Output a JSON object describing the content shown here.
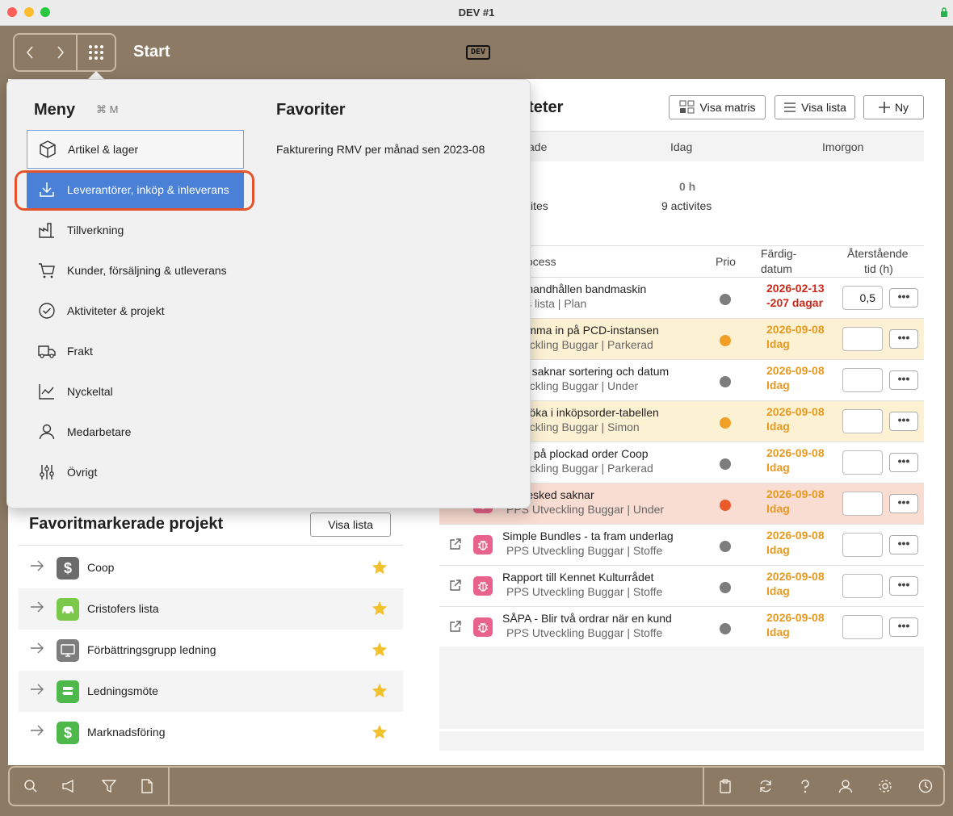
{
  "window": {
    "title": "DEV #1"
  },
  "header": {
    "page_title": "Start",
    "logo_text": "DEV"
  },
  "menu": {
    "title": "Meny",
    "shortcut": "⌘ M",
    "items": [
      {
        "label": "Artikel & lager",
        "icon": "box-icon"
      },
      {
        "label": "Leverantörer, inköp & inleverans",
        "icon": "download-icon"
      },
      {
        "label": "Tillverkning",
        "icon": "factory-icon"
      },
      {
        "label": "Kunder, försäljning & utleverans",
        "icon": "cart-icon"
      },
      {
        "label": "Aktiviteter & projekt",
        "icon": "check-circle-icon"
      },
      {
        "label": "Frakt",
        "icon": "truck-icon"
      },
      {
        "label": "Nyckeltal",
        "icon": "line-chart-icon"
      },
      {
        "label": "Medarbetare",
        "icon": "person-icon"
      },
      {
        "label": "Övrigt",
        "icon": "sliders-icon"
      }
    ]
  },
  "favorites": {
    "title": "Favoriter",
    "links": [
      "Fakturering RMV per månad sen 2023-08"
    ]
  },
  "activities": {
    "title": "erade aktiviteter",
    "buttons": {
      "matrix": "Visa matris",
      "list": "Visa lista",
      "new": "Ny"
    },
    "summary_headers": [
      "ade",
      "Idag",
      "Imorgon"
    ],
    "summary_values": {
      "col1_count": "ites",
      "today_hours": "0 h",
      "today_count": "9 activites"
    },
    "table_headers": {
      "process": "ocess",
      "prio": "Prio",
      "date_l1": "Färdig-",
      "date_l2": "datum",
      "rem_l1": "Återstående",
      "rem_l2": "tid (h)"
    },
    "more_label": "•••",
    "rows": [
      {
        "title": "rhåll handhållen bandmaskin",
        "sub": "ofers lista | Plan",
        "prio": "#7d7d7d",
        "date": "2026-02-13",
        "due": "-207 dagar",
        "date_color": "#c92a1b",
        "remaining": "0,5",
        "bg": "#ffffff"
      },
      {
        "title": "te komma in på PCD-instansen",
        "sub": "Utveckling Buggar | Parkerad",
        "prio": "#f0a027",
        "date": "2026-09-08",
        "due": "Idag",
        "date_color": "#e69a22",
        "remaining": "",
        "bg": "#fdf1d4"
      },
      {
        "title": "listan saknar sortering och datum",
        "sub": "Utveckling Buggar | Under",
        "prio": "#7d7d7d",
        "date": "2026-09-08",
        "due": "Idag",
        "date_color": "#e69a22",
        "remaining": "",
        "bg": "#ffffff"
      },
      {
        "title": "j att söka i inköpsorder-tabellen",
        "sub": "Utveckling Buggar | Simon",
        "prio": "#f0a027",
        "date": "2026-09-08",
        "due": "Idag",
        "date_color": "#e69a22",
        "remaining": "",
        "bg": "#fdf1d4"
      },
      {
        "title": "ner in på plockad order Coop",
        "sub": "Utveckling Buggar | Parkerad",
        "prio": "#7d7d7d",
        "date": "2026-09-08",
        "due": "Idag",
        "date_color": "#e69a22",
        "remaining": "",
        "bg": "#ffffff"
      },
      {
        "title": "ansbesked saknar",
        "sub": "PPS Utveckling Buggar | Under",
        "prio": "#ea5a2b",
        "date": "2026-09-08",
        "due": "Idag",
        "date_color": "#e69a22",
        "remaining": "",
        "bg": "#f9dcd2"
      },
      {
        "title": "Simple Bundles - ta fram underlag",
        "sub": "PPS Utveckling Buggar | Stoffe",
        "prio": "#7d7d7d",
        "date": "2026-09-08",
        "due": "Idag",
        "date_color": "#e69a22",
        "remaining": "",
        "bg": "#ffffff"
      },
      {
        "title": "Rapport till Kennet Kulturrådet",
        "sub": "PPS Utveckling Buggar | Stoffe",
        "prio": "#7d7d7d",
        "date": "2026-09-08",
        "due": "Idag",
        "date_color": "#e69a22",
        "remaining": "",
        "bg": "#ffffff"
      },
      {
        "title": "SÅPA - Blir två ordrar när en kund",
        "sub": "PPS Utveckling Buggar | Stoffe",
        "prio": "#7d7d7d",
        "date": "2026-09-08",
        "due": "Idag",
        "date_color": "#e69a22",
        "remaining": "",
        "bg": "#ffffff"
      }
    ]
  },
  "favorite_projects": {
    "title": "Favoritmarkerade projekt",
    "button": "Visa lista",
    "items": [
      {
        "name": "Coop",
        "icon": "dollar-icon",
        "color": "#6b6b6b",
        "glyph": "$"
      },
      {
        "name": "Cristofers lista",
        "icon": "car-icon",
        "color": "#7cc84a",
        "glyph": ""
      },
      {
        "name": "Förbättringsgrupp ledning",
        "icon": "monitor-icon",
        "color": "#7d7d7d",
        "glyph": ""
      },
      {
        "name": "Ledningsmöte",
        "icon": "signpost-icon",
        "color": "#4fb84a",
        "glyph": ""
      },
      {
        "name": "Marknadsföring",
        "icon": "dollar-icon",
        "color": "#4fb84a",
        "glyph": "$"
      }
    ]
  },
  "colors": {
    "brand_brown": "#8c7a64",
    "accent_blue": "#4a80d6",
    "highlight_red": "#e5532c",
    "star": "#f2c12e"
  }
}
